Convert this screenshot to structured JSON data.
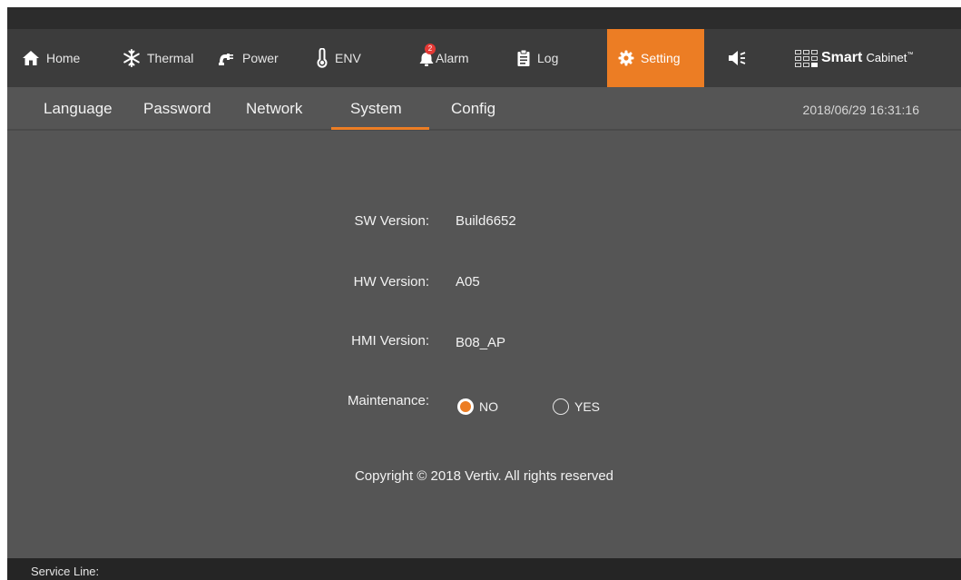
{
  "nav": {
    "home": "Home",
    "thermal": "Thermal",
    "power": "Power",
    "env": "ENV",
    "alarm": "Alarm",
    "alarm_count": "2",
    "log": "Log",
    "setting": "Setting",
    "active": "Setting",
    "accent_color": "#ec7d24"
  },
  "brand": {
    "smart": "Smart",
    "cabinet": "Cabinet",
    "tm": "™"
  },
  "subtabs": {
    "items": [
      "Language",
      "Password",
      "Network",
      "System",
      "Config"
    ],
    "active": "System"
  },
  "datetime": "2018/06/29 16:31:16",
  "system": {
    "sw_label": "SW Version:",
    "sw_value": "Build6652",
    "hw_label": "HW Version:",
    "hw_value": "A05",
    "hmi_label": "HMI Version:",
    "hmi_value": "B08_AP",
    "maintenance_label": "Maintenance:",
    "maintenance_options": [
      "NO",
      "YES"
    ],
    "maintenance_selected": "NO"
  },
  "copyright": "Copyright © 2018 Vertiv. All rights reserved",
  "footer": {
    "service_line": "Service Line:"
  }
}
